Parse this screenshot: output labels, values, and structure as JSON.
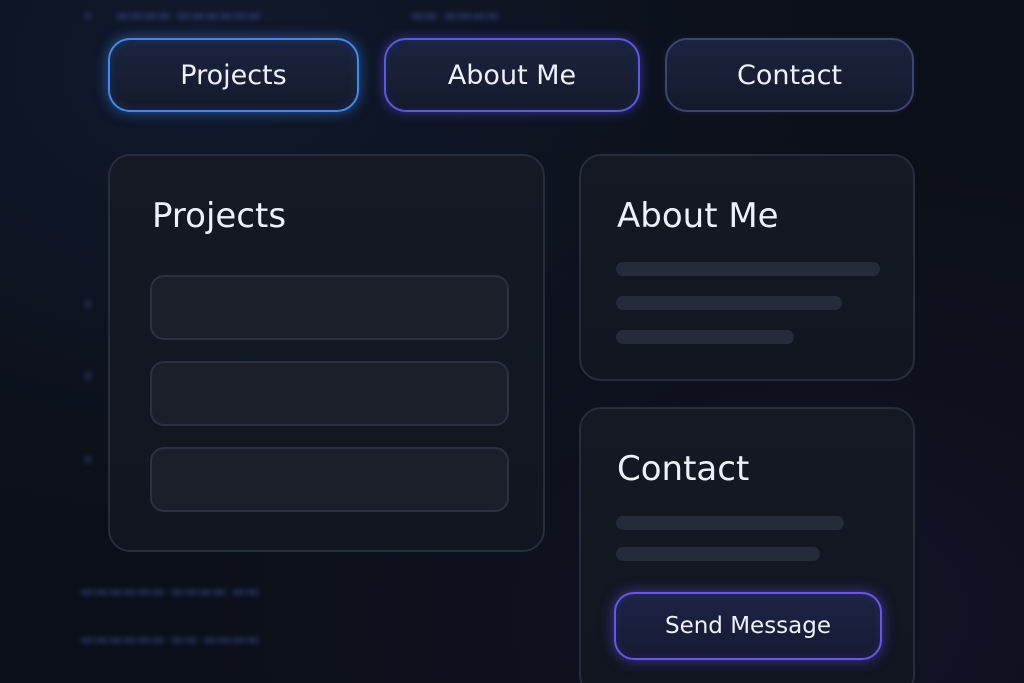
{
  "nav": {
    "items": [
      {
        "label": "Projects",
        "active": true
      },
      {
        "label": "About Me",
        "active": false
      },
      {
        "label": "Contact",
        "active": false
      }
    ]
  },
  "cards": {
    "projects": {
      "title": "Projects",
      "slot_count": 3
    },
    "about": {
      "title": "About Me"
    },
    "contact": {
      "title": "Contact",
      "button_label": "Send Message"
    }
  },
  "colors": {
    "background": "#0b0f17",
    "card": "#141924",
    "accent_blue": "#3d8bf0",
    "accent_violet": "#6a55f0",
    "text": "#eef1f7"
  }
}
